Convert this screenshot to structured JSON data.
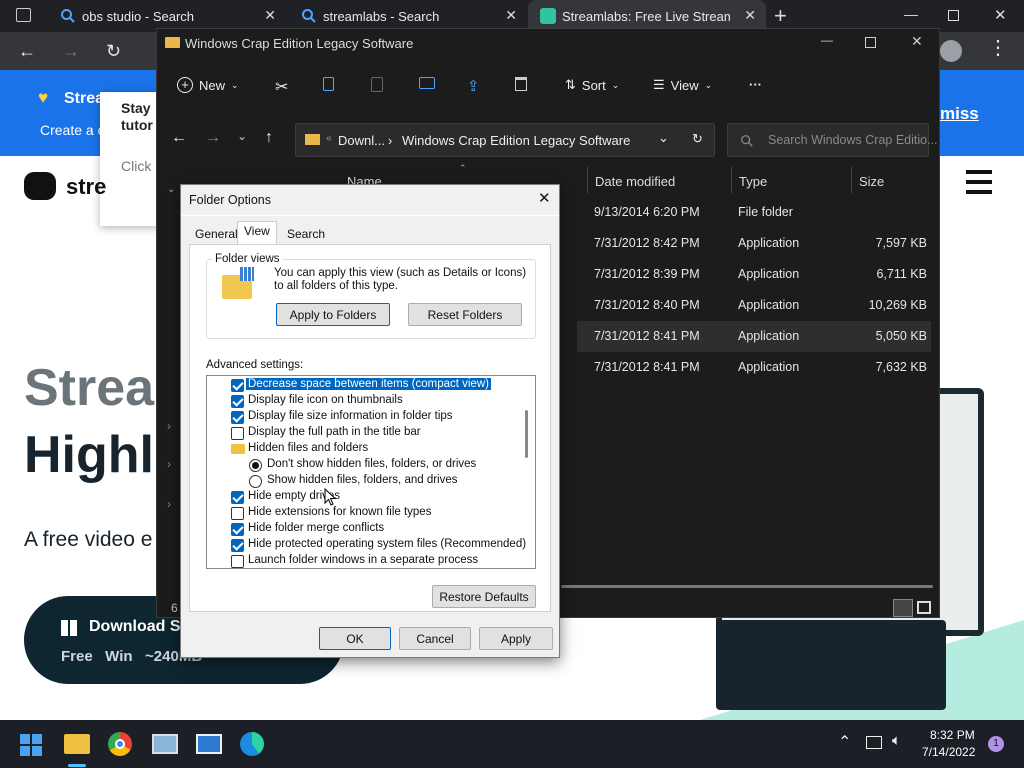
{
  "browser": {
    "tabs": [
      {
        "label": "obs studio - Search",
        "active": false
      },
      {
        "label": "streamlabs - Search",
        "active": false
      },
      {
        "label": "Streamlabs: Free Live Streaming",
        "active": true
      }
    ]
  },
  "website": {
    "banner_title": "Strea",
    "banner_sub": "Create a c",
    "banner_dismiss": "miss",
    "popup_line1": "Stay",
    "popup_line2": "tutor",
    "popup_line3": "Click",
    "logo_text": "stre",
    "hero_line1": "Strear",
    "hero_line2": "Highli",
    "hero_sub": "A free video e",
    "download_label": "Download St",
    "download_meta": "Free   Win   ~240MB"
  },
  "explorer": {
    "title": "Windows Crap Edition Legacy Software",
    "toolbar": {
      "new": "New",
      "sort": "Sort",
      "view": "View",
      "more": "···"
    },
    "path_parent": "Downl...",
    "path_current": "Windows Crap Edition Legacy Software",
    "search_placeholder": "Search Windows Crap Editio...",
    "columns": {
      "name": "Name",
      "date": "Date modified",
      "type": "Type",
      "size": "Size"
    },
    "rows": [
      {
        "date": "9/13/2014 6:20 PM",
        "type": "File folder",
        "size": ""
      },
      {
        "date": "7/31/2012 8:42 PM",
        "type": "Application",
        "size": "7,597 KB"
      },
      {
        "date": "7/31/2012 8:39 PM",
        "type": "Application",
        "size": "6,711 KB"
      },
      {
        "date": "7/31/2012 8:40 PM",
        "type": "Application",
        "size": "10,269 KB"
      },
      {
        "date": "7/31/2012 8:41 PM",
        "type": "Application",
        "size": "5,050 KB"
      },
      {
        "date": "7/31/2012 8:41 PM",
        "type": "Application",
        "size": "7,632 KB"
      }
    ],
    "status_count": "6"
  },
  "dialog": {
    "title": "Folder Options",
    "tabs": [
      "General",
      "View",
      "Search"
    ],
    "folder_views_label": "Folder views",
    "folder_views_text": "You can apply this view (such as Details or Icons) to all folders of this type.",
    "apply_to_folders": "Apply to Folders",
    "reset_folders": "Reset Folders",
    "advanced_label": "Advanced settings:",
    "advanced_items": [
      {
        "kind": "check",
        "checked": true,
        "label": "Decrease space between items (compact view)",
        "selected": true
      },
      {
        "kind": "check",
        "checked": true,
        "label": "Display file icon on thumbnails"
      },
      {
        "kind": "check",
        "checked": true,
        "label": "Display file size information in folder tips"
      },
      {
        "kind": "check",
        "checked": false,
        "label": "Display the full path in the title bar"
      },
      {
        "kind": "folder",
        "label": "Hidden files and folders"
      },
      {
        "kind": "radio",
        "checked": true,
        "label": "Don't show hidden files, folders, or drives"
      },
      {
        "kind": "radio",
        "checked": false,
        "label": "Show hidden files, folders, and drives"
      },
      {
        "kind": "check",
        "checked": true,
        "label": "Hide empty drives"
      },
      {
        "kind": "check",
        "checked": false,
        "label": "Hide extensions for known file types"
      },
      {
        "kind": "check",
        "checked": true,
        "label": "Hide folder merge conflicts"
      },
      {
        "kind": "check",
        "checked": true,
        "label": "Hide protected operating system files (Recommended)"
      },
      {
        "kind": "check",
        "checked": false,
        "label": "Launch folder windows in a separate process"
      }
    ],
    "restore_defaults": "Restore Defaults",
    "ok": "OK",
    "cancel": "Cancel",
    "apply": "Apply"
  },
  "taskbar": {
    "time": "8:32 PM",
    "date": "7/14/2022",
    "notification_count": "1"
  },
  "colors": {
    "accent": "#0067c0",
    "banner": "#1a73e8",
    "explorer_bg": "#1c1c1c"
  }
}
